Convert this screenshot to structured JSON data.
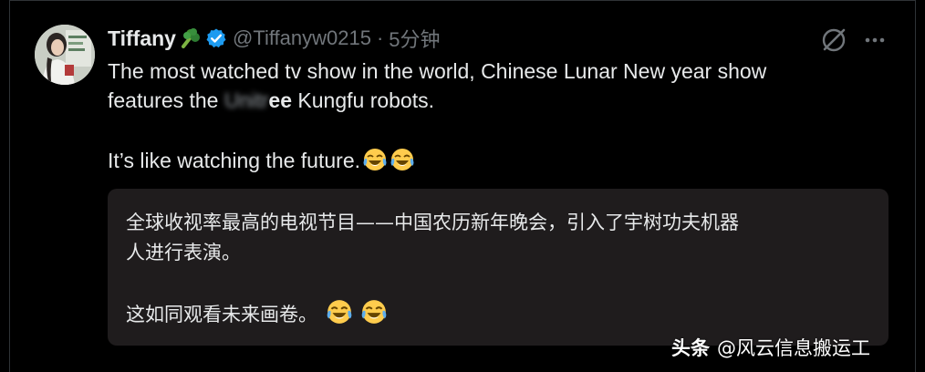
{
  "author": {
    "display_name": "Tiffany",
    "name_emoji": "broccoli-icon",
    "verified": true,
    "handle": "@Tiffanyw0215",
    "separator": "·",
    "time": "5分钟"
  },
  "actions": {
    "grok_icon": "grok-icon",
    "more_icon": "more-options-icon"
  },
  "tweet": {
    "line1": "The most watched tv show in the world, Chinese Lunar New year show",
    "line2_prefix": "features the ",
    "line2_blurred": "Unitr",
    "line2_visible": "ee",
    "line2_suffix": " Kungfu robots.",
    "line3": "It’s like watching the future."
  },
  "translation": {
    "line1": "全球收视率最高的电视节目——中国农历新年晚会，引入了宇树功夫机器",
    "line2": "人进行表演。",
    "line3": "这如同观看未来画卷。"
  },
  "watermark": {
    "brand": "头条",
    "account": "@风云信息搬运工"
  },
  "colors": {
    "background": "#000000",
    "text": "#e7e9ea",
    "secondary": "#71767b",
    "verified_blue": "#1d9bf0",
    "translation_bg": "#1f1c1d"
  }
}
